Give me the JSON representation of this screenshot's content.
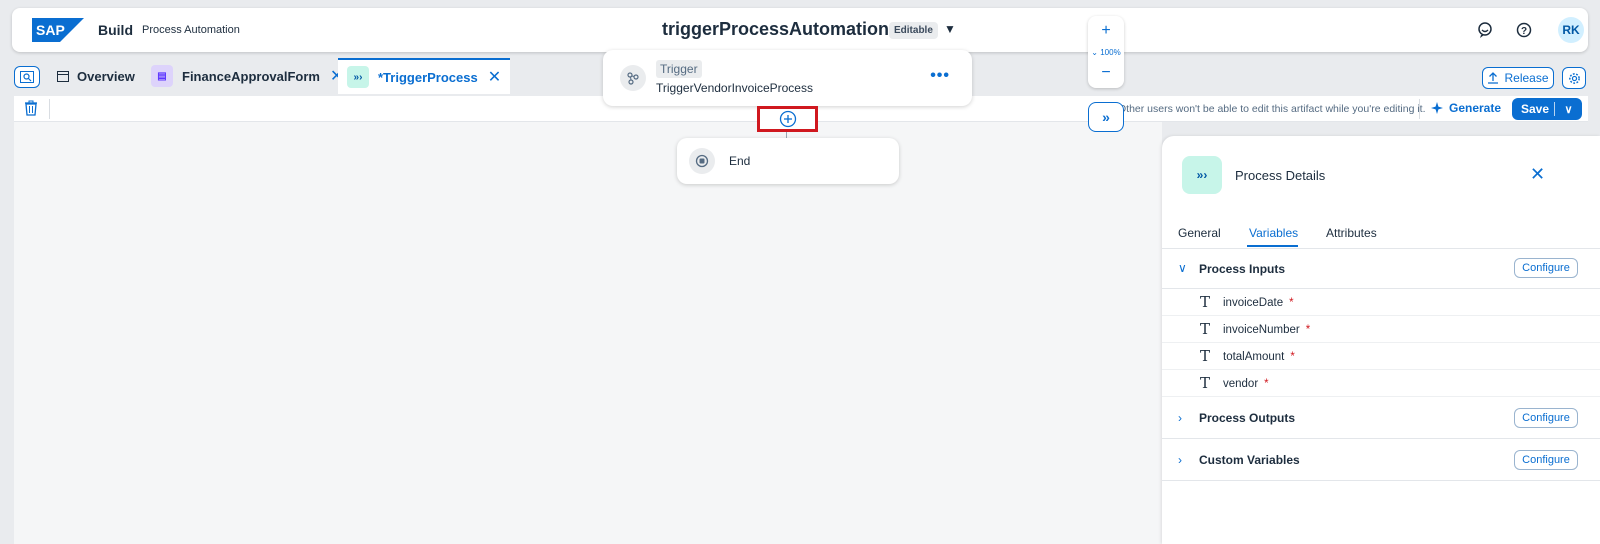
{
  "header": {
    "logo_text": "SAP",
    "brand": "Build",
    "product": "Process Automation",
    "title": "triggerProcessAutomation",
    "status_badge": "Editable",
    "avatar_initials": "RK"
  },
  "tabs": [
    {
      "label": "Overview",
      "icon": "overview-icon"
    },
    {
      "label": "FinanceApprovalForm",
      "icon": "form-icon",
      "closable": true
    },
    {
      "label": "*TriggerProcess",
      "icon": "process-icon",
      "closable": true,
      "active": true
    }
  ],
  "tab_actions": {
    "release_label": "Release"
  },
  "toolbar": {
    "notice": "Other users won't be able to edit this artifact while you're editing it.",
    "generate_label": "Generate",
    "save_label": "Save"
  },
  "canvas": {
    "trigger_node": {
      "chip": "Trigger",
      "name": "TriggerVendorInvoiceProcess"
    },
    "end_node": {
      "label": "End"
    },
    "zoom_level": "100%"
  },
  "panel": {
    "title": "Process Details",
    "tabs": [
      "General",
      "Variables",
      "Attributes"
    ],
    "active_tab": "Variables",
    "configure_label": "Configure",
    "process_inputs": {
      "label": "Process Inputs",
      "variables": [
        {
          "name": "invoiceDate",
          "required": "*"
        },
        {
          "name": "invoiceNumber",
          "required": "*"
        },
        {
          "name": "totalAmount",
          "required": "*"
        },
        {
          "name": "vendor",
          "required": "*"
        }
      ]
    },
    "process_outputs": {
      "label": "Process Outputs"
    },
    "custom_variables": {
      "label": "Custom Variables"
    }
  },
  "colors": {
    "accent": "#0a6ed1",
    "highlight": "#d0181f",
    "process_icon_bg": "#c7f5e9"
  }
}
